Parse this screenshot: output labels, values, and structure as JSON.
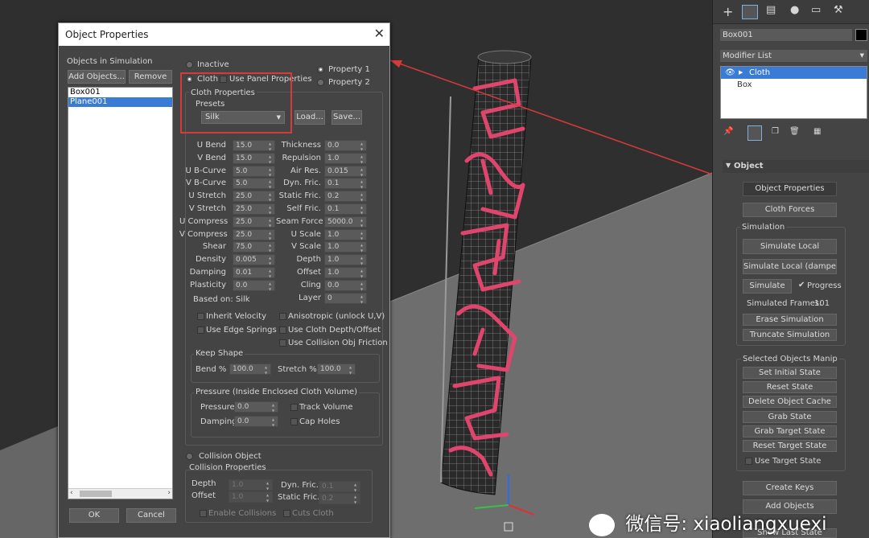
{
  "dialog": {
    "title": "Object Properties",
    "objects_label": "Objects in Simulation",
    "add_objects": "Add Objects...",
    "remove": "Remove",
    "objects": [
      "Box001",
      "Plane001"
    ],
    "ok": "OK",
    "cancel": "Cancel",
    "inactive": "Inactive",
    "cloth": "Cloth",
    "use_panel_props": "Use Panel Properties",
    "property1": "Property 1",
    "property2": "Property 2",
    "cloth_props": "Cloth Properties",
    "presets_label": "Presets",
    "preset_value": "Silk",
    "load": "Load...",
    "save": "Save...",
    "left_params": [
      {
        "label": "U Bend",
        "value": "15.0"
      },
      {
        "label": "V Bend",
        "value": "15.0"
      },
      {
        "label": "U B-Curve",
        "value": "5.0"
      },
      {
        "label": "V B-Curve",
        "value": "5.0"
      },
      {
        "label": "U Stretch",
        "value": "25.0"
      },
      {
        "label": "V Stretch",
        "value": "25.0"
      },
      {
        "label": "U Compress",
        "value": "25.0"
      },
      {
        "label": "V Compress",
        "value": "25.0"
      },
      {
        "label": "Shear",
        "value": "75.0"
      },
      {
        "label": "Density",
        "value": "0.005"
      },
      {
        "label": "Damping",
        "value": "0.01"
      },
      {
        "label": "Plasticity",
        "value": "0.0"
      }
    ],
    "right_params": [
      {
        "label": "Thickness",
        "value": "0.0"
      },
      {
        "label": "Repulsion",
        "value": "1.0"
      },
      {
        "label": "Air Res.",
        "value": "0.015"
      },
      {
        "label": "Dyn. Fric.",
        "value": "0.1"
      },
      {
        "label": "Static Fric.",
        "value": "0.2"
      },
      {
        "label": "Self Fric.",
        "value": "0.1"
      },
      {
        "label": "Seam Force",
        "value": "5000.0"
      },
      {
        "label": "U Scale",
        "value": "1.0"
      },
      {
        "label": "V Scale",
        "value": "1.0"
      },
      {
        "label": "Depth",
        "value": "1.0"
      },
      {
        "label": "Offset",
        "value": "1.0"
      },
      {
        "label": "Cling",
        "value": "0.0"
      },
      {
        "label": "Layer",
        "value": "0"
      }
    ],
    "based_on": "Based on: Silk",
    "inherit_velocity": "Inherit Velocity",
    "use_edge_springs": "Use Edge Springs",
    "anisotropic": "Anisotropic (unlock U,V)",
    "use_cloth_depth": "Use Cloth Depth/Offset",
    "use_collision_friction": "Use Collision Obj Friction",
    "keep_shape": "Keep Shape",
    "bend_pct_label": "Bend %",
    "bend_pct": "100.0",
    "stretch_pct_label": "Stretch %",
    "stretch_pct": "100.0",
    "pressure_title": "Pressure (Inside Enclosed Cloth Volume)",
    "pressure_label": "Pressure",
    "pressure": "0.0",
    "damping_label": "Damping",
    "damping": "0.0",
    "track_volume": "Track Volume",
    "cap_holes": "Cap Holes",
    "collision_object": "Collision Object",
    "collision_props": "Collision Properties",
    "c_depth_label": "Depth",
    "c_depth": "1.0",
    "c_offset_label": "Offset",
    "c_offset": "1.0",
    "c_dyn_label": "Dyn. Fric.",
    "c_dyn": "0.1",
    "c_static_label": "Static Fric.",
    "c_static": "0.2",
    "enable_collisions": "Enable Collisions",
    "cuts_cloth": "Cuts Cloth"
  },
  "panel": {
    "object_name": "Box001",
    "modifier_list": "Modifier List",
    "stack": [
      "Cloth",
      "Box"
    ],
    "section": "Object",
    "object_properties": "Object Properties",
    "cloth_forces": "Cloth Forces",
    "simulation_label": "Simulation",
    "simulate_local": "Simulate Local",
    "simulate_local_damped": "Simulate Local (damped)",
    "simulate": "Simulate",
    "progress": "Progress",
    "simulated_frames": "Simulated Frames:",
    "frames_value": "101",
    "erase_simulation": "Erase Simulation",
    "truncate_simulation": "Truncate Simulation",
    "selected_manip": "Selected Objects Manip",
    "set_initial_state": "Set Initial State",
    "reset_state": "Reset State",
    "delete_object_cache": "Delete Object Cache",
    "grab_state": "Grab State",
    "grab_target_state": "Grab Target State",
    "reset_target_state": "Reset Target State",
    "use_target_state": "Use Target State",
    "create_keys": "Create Keys",
    "add_objects": "Add Objects",
    "show_last_state": "Show Last State"
  },
  "watermark": "微信号: xiaoliangxuexi",
  "colors": {
    "highlight": "#d63a3a",
    "selection": "#3a7bd5",
    "cloth_pattern": "#e0456e"
  }
}
